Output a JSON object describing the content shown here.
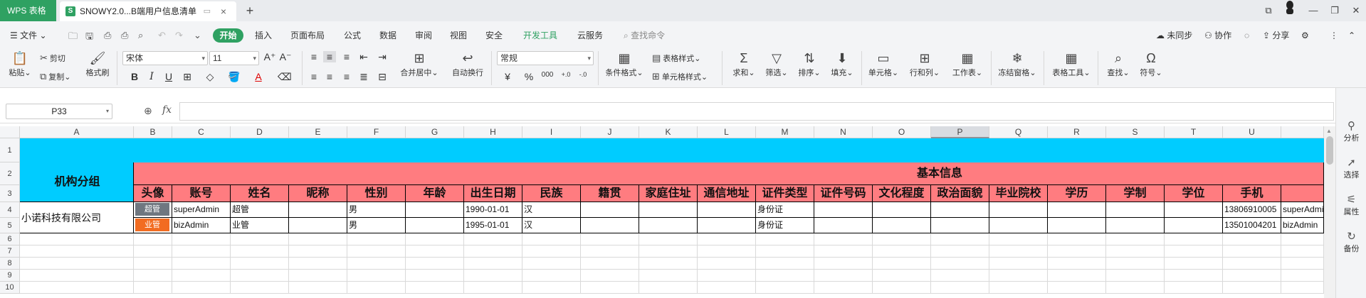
{
  "tabs": {
    "app_label": "WPS 表格",
    "doc_icon": "S",
    "doc_title": "SNOWY2.0...B端用户信息清单"
  },
  "menu": {
    "file": "文件",
    "items": [
      "开始",
      "插入",
      "页面布局",
      "公式",
      "数据",
      "审阅",
      "视图",
      "安全",
      "开发工具",
      "云服务"
    ],
    "search": "查找命令",
    "sync": "未同步",
    "collab": "协作",
    "share": "分享"
  },
  "ribbon": {
    "paste": "粘贴",
    "cut": "剪切",
    "copy": "复制",
    "format_painter": "格式刷",
    "font_name": "宋体",
    "font_size": "11",
    "number_format": "常规",
    "merge_center": "合并居中",
    "auto_wrap": "自动换行",
    "cond_format": "条件格式",
    "table_style": "表格样式",
    "cell_style": "单元格样式",
    "sum": "求和",
    "filter": "筛选",
    "sort": "排序",
    "fill": "填充",
    "cell": "单元格",
    "row_col": "行和列",
    "worksheet": "工作表",
    "freeze": "冻结窗格",
    "table_tools": "表格工具",
    "find": "查找",
    "symbol": "符号"
  },
  "formula": {
    "cell_ref": "P33",
    "fx": "fx",
    "value": ""
  },
  "sheet": {
    "columns": [
      "A",
      "B",
      "C",
      "D",
      "E",
      "F",
      "G",
      "H",
      "I",
      "J",
      "K",
      "L",
      "M",
      "N",
      "O",
      "P",
      "Q",
      "R",
      "S",
      "T",
      "U"
    ],
    "selected_column": "P",
    "rows": [
      "1",
      "2",
      "3",
      "4",
      "5",
      "6",
      "7",
      "8",
      "9",
      "10"
    ],
    "group_label": "机构分组",
    "section_label": "基本信息",
    "headers": [
      "头像",
      "账号",
      "姓名",
      "昵称",
      "性别",
      "年龄",
      "出生日期",
      "民族",
      "籍贯",
      "家庭住址",
      "通信地址",
      "证件类型",
      "证件号码",
      "文化程度",
      "政治面貌",
      "毕业院校",
      "学历",
      "学制",
      "学位",
      "手机"
    ],
    "org_name": "小诺科技有限公司",
    "records": [
      {
        "avatar": "超管",
        "avatar_color": "#6f7780",
        "account": "superAdmin",
        "name": "超管",
        "gender": "男",
        "birth": "1990-01-01",
        "ethnic": "汉",
        "id_type": "身份证",
        "phone": "13806910005",
        "extra": "superAdmin"
      },
      {
        "avatar": "业管",
        "avatar_color": "#f26c21",
        "account": "bizAdmin",
        "name": "业管",
        "gender": "男",
        "birth": "1995-01-01",
        "ethnic": "汉",
        "id_type": "身份证",
        "phone": "13501004201",
        "extra": "bizAdmin"
      }
    ],
    "header_color": "#ff7c80",
    "banner_color": "#00ccff"
  },
  "right_panel": {
    "items": [
      "分析",
      "选择",
      "属性",
      "备份"
    ]
  }
}
